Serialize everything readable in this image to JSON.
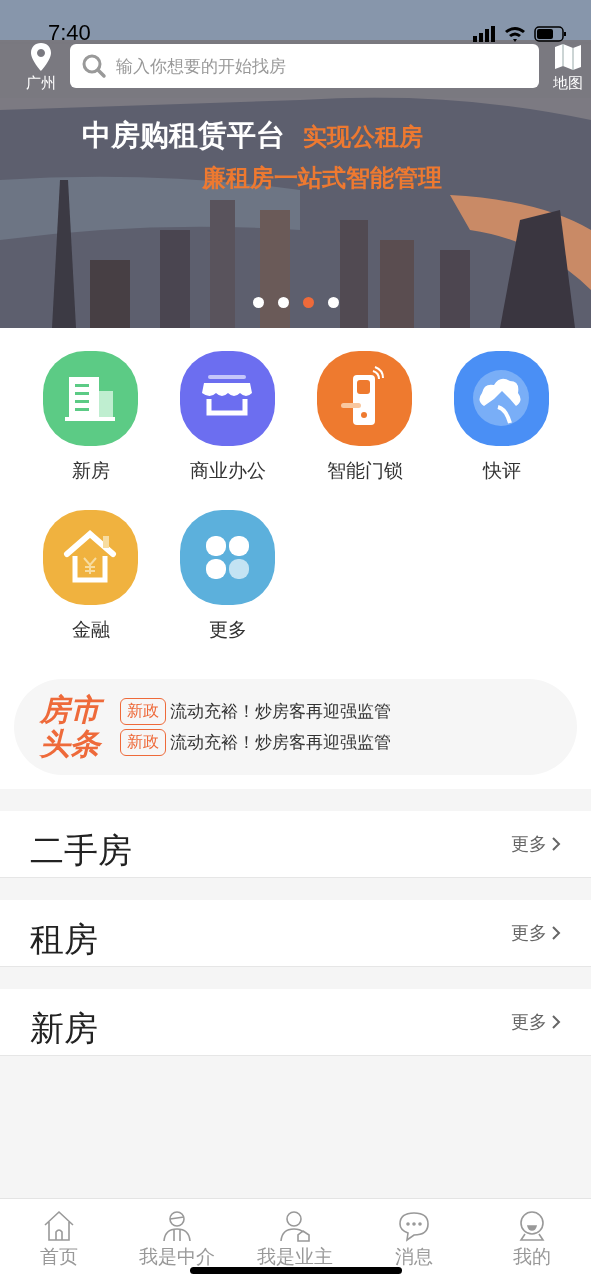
{
  "status_bar": {
    "time": "7:40"
  },
  "header": {
    "city": "广州",
    "search": {
      "placeholder": "输入你想要的开始找房"
    },
    "map_label": "地图"
  },
  "banner": {
    "headline": "中房购租赁平台",
    "highlight": "实现公租房",
    "subline": "廉租房一站式智能管理",
    "dots": [
      {
        "selected": false
      },
      {
        "selected": false
      },
      {
        "selected": true
      },
      {
        "selected": false
      }
    ]
  },
  "categories": [
    {
      "label": "新房",
      "kind": "building",
      "color": "#5ccb85"
    },
    {
      "label": "商业办公",
      "kind": "shop",
      "color": "#6c6ef0"
    },
    {
      "label": "智能门锁",
      "kind": "lock",
      "color": "#ee7a2f"
    },
    {
      "label": "快评",
      "kind": "cloud",
      "color": "#4a8ff5"
    },
    {
      "label": "金融",
      "kind": "finance",
      "color": "#f0b23f"
    },
    {
      "label": "更多",
      "kind": "more",
      "color": "#5cb0dc"
    }
  ],
  "news": {
    "logo_top": "房市",
    "logo_bottom": "头条",
    "items": [
      {
        "tag": "新政",
        "text": "流动充裕！炒房客再迎强监管"
      },
      {
        "tag": "新政",
        "text": "流动充裕！炒房客再迎强监管"
      }
    ]
  },
  "sections": [
    {
      "title": "二手房",
      "more": "更多"
    },
    {
      "title": "租房",
      "more": "更多"
    },
    {
      "title": "新房",
      "more": "更多"
    }
  ],
  "tabs": [
    {
      "label": "首页",
      "kind": "home",
      "selected": false
    },
    {
      "label": "我是中介",
      "kind": "agent",
      "selected": false
    },
    {
      "label": "我是业主",
      "kind": "owner",
      "selected": false
    },
    {
      "label": "消息",
      "kind": "message",
      "selected": false
    },
    {
      "label": "我的",
      "kind": "me",
      "selected": false
    }
  ]
}
